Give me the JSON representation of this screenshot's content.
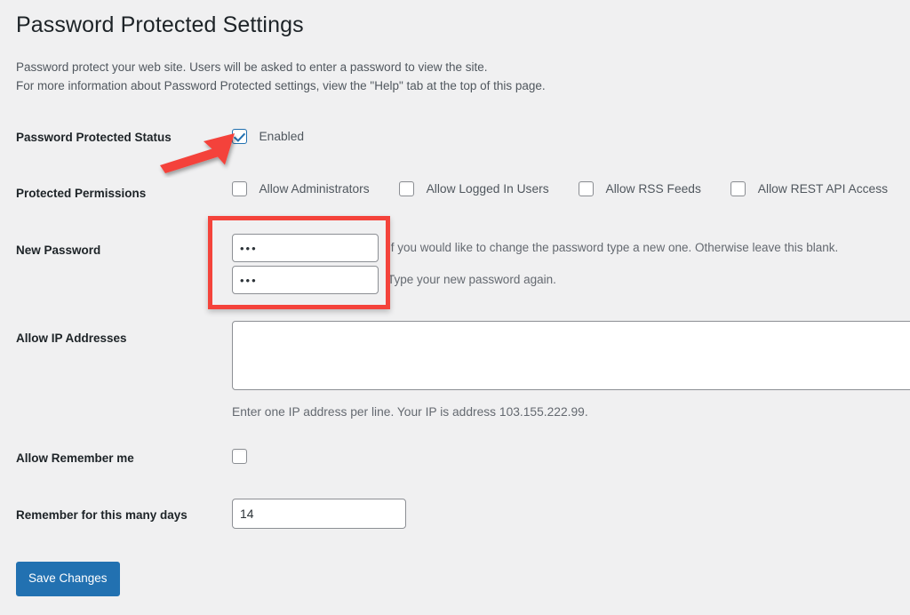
{
  "page": {
    "title": "Password Protected Settings",
    "background_color": "#f0f0f1",
    "intro_line_1": "Password protect your web site. Users will be asked to enter a password to view the site.",
    "intro_line_2": "For more information about Password Protected settings, view the \"Help\" tab at the top of this page."
  },
  "accent_colors": {
    "primary_blue": "#2271b1",
    "annotation_red": "#f4433b",
    "label_text": "#1d2327",
    "body_text": "#50575e",
    "muted_text": "#646970"
  },
  "rows": {
    "status": {
      "label": "Password Protected Status",
      "checkbox_label": "Enabled",
      "checked": true
    },
    "permissions": {
      "label": "Protected Permissions",
      "options": [
        {
          "label": "Allow Administrators",
          "checked": false
        },
        {
          "label": "Allow Logged In Users",
          "checked": false
        },
        {
          "label": "Allow RSS Feeds",
          "checked": false
        },
        {
          "label": "Allow REST API Access",
          "checked": false
        }
      ]
    },
    "new_password": {
      "label": "New Password",
      "password_value": "•••",
      "password_placeholder": "",
      "password_description": "If you would like to change the password type a new one. Otherwise leave this blank.",
      "confirm_value": "•••",
      "confirm_placeholder": "",
      "confirm_description": "Type your new password again."
    },
    "allow_ip": {
      "label": "Allow IP Addresses",
      "value": "",
      "placeholder": "",
      "description": "Enter one IP address per line. Your IP is address 103.155.222.99."
    },
    "remember_me": {
      "label": "Allow Remember me",
      "checked": false
    },
    "remember_days": {
      "label": "Remember for this many days",
      "value": "14",
      "placeholder": ""
    }
  },
  "actions": {
    "save_label": "Save Changes"
  },
  "annotations": {
    "arrow": {
      "name": "red-arrow-pointing-to-enabled-checkbox",
      "color": "#f4433b"
    },
    "box": {
      "name": "red-highlight-box-around-password-fields",
      "color": "#f4433b"
    }
  }
}
